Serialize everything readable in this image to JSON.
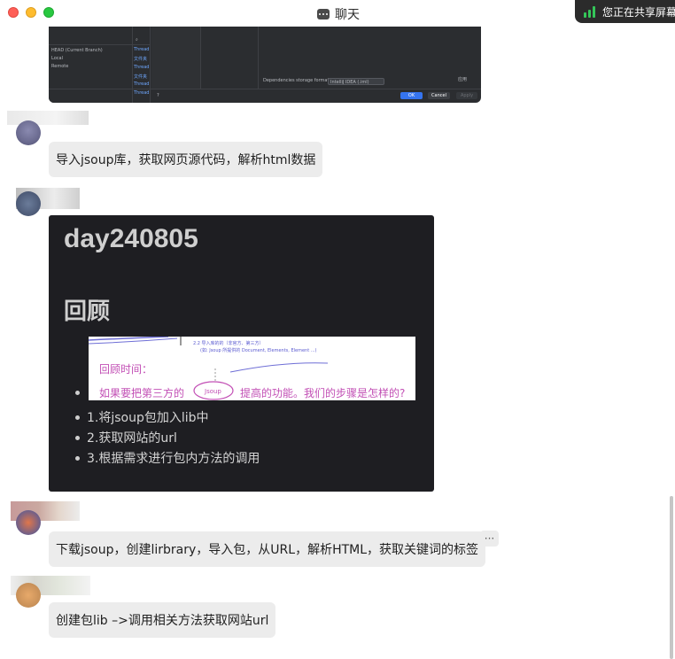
{
  "window": {
    "title": "聊天",
    "share_status": "您正在共享屏幕"
  },
  "ide_screenshot": {
    "left_items": [
      "HEAD (Current Branch)",
      "Local",
      "Remote"
    ],
    "thread_items": [
      "Thread",
      "文件夹",
      "Thread",
      "文件夹",
      "Thread",
      "Thread"
    ],
    "storage_label": "Dependencies storage format:",
    "storage_value": "IntelliJ IDEA (.iml)",
    "ok_label": "OK",
    "cancel_label": "Cancel",
    "apply_label": "Apply",
    "apply_cn": "应用"
  },
  "messages": [
    {
      "text": "导入jsoup库，获取网页源代码，解析html数据"
    },
    {
      "text": "下载jsoup，创建lirbrary，导入包，从URL，解析HTML，获取关键词的标签"
    },
    {
      "text": "创建包lib –>调用相关方法获取网站url"
    }
  ],
  "note": {
    "title": "day240805",
    "heading": "回顾",
    "handwriting": {
      "line1": "回顾时间：",
      "line2a": "如果要把第三方的",
      "circled": "Jsoup",
      "line2b": "提高的功能。我们的步骤是怎样的?",
      "small1": "2.2 导入库的的（非官方、第三方）",
      "small2": "(如: Jsoup 所提供的 Document, Elements, Element ...)"
    },
    "bullets": [
      "1.将jsoup包加入lib中",
      "2.获取网站的url",
      "3.根据需求进行包内方法的调用"
    ]
  },
  "more_label": "···"
}
